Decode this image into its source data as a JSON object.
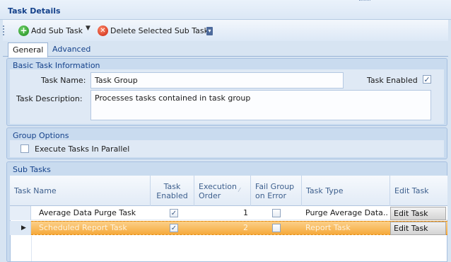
{
  "window": {
    "title": "Task Details"
  },
  "toolbar": {
    "add_label": "Add Sub Task",
    "delete_label": "Delete Selected Sub Task",
    "add_icon": "plus-circle-icon",
    "delete_icon": "x-circle-icon"
  },
  "tabs": [
    {
      "label": "General",
      "selected": true
    },
    {
      "label": "Advanced",
      "selected": false
    }
  ],
  "basic_info": {
    "title": "Basic Task Information",
    "name_label": "Task Name:",
    "name_value": "Task Group",
    "description_label": "Task Description:",
    "description_value": "Processes tasks contained in task group",
    "enabled_label": "Task Enabled",
    "enabled_checked": true
  },
  "group_options": {
    "title": "Group Options",
    "parallel_label": "Execute Tasks In Parallel",
    "parallel_checked": false
  },
  "sub_tasks": {
    "title": "Sub Tasks",
    "columns": {
      "name": "Task Name",
      "enabled": "Task Enabled",
      "order": "Execution Order",
      "fail": "Fail Group on Error",
      "type": "Task Type",
      "edit": "Edit Task"
    },
    "rows": [
      {
        "name": "Average Data Purge Task",
        "enabled": true,
        "order": "1",
        "fail_on_error": false,
        "type": "Purge Average Data...",
        "edit_label": "Edit Task",
        "selected": false
      },
      {
        "name": "Scheduled Report Task",
        "enabled": true,
        "order": "2",
        "fail_on_error": false,
        "type": "Report Task",
        "edit_label": "Edit Task",
        "selected": true
      }
    ]
  },
  "colors": {
    "accent": "#15428b",
    "selected_row": "#f6a93a",
    "panel": "#c9dbef"
  }
}
